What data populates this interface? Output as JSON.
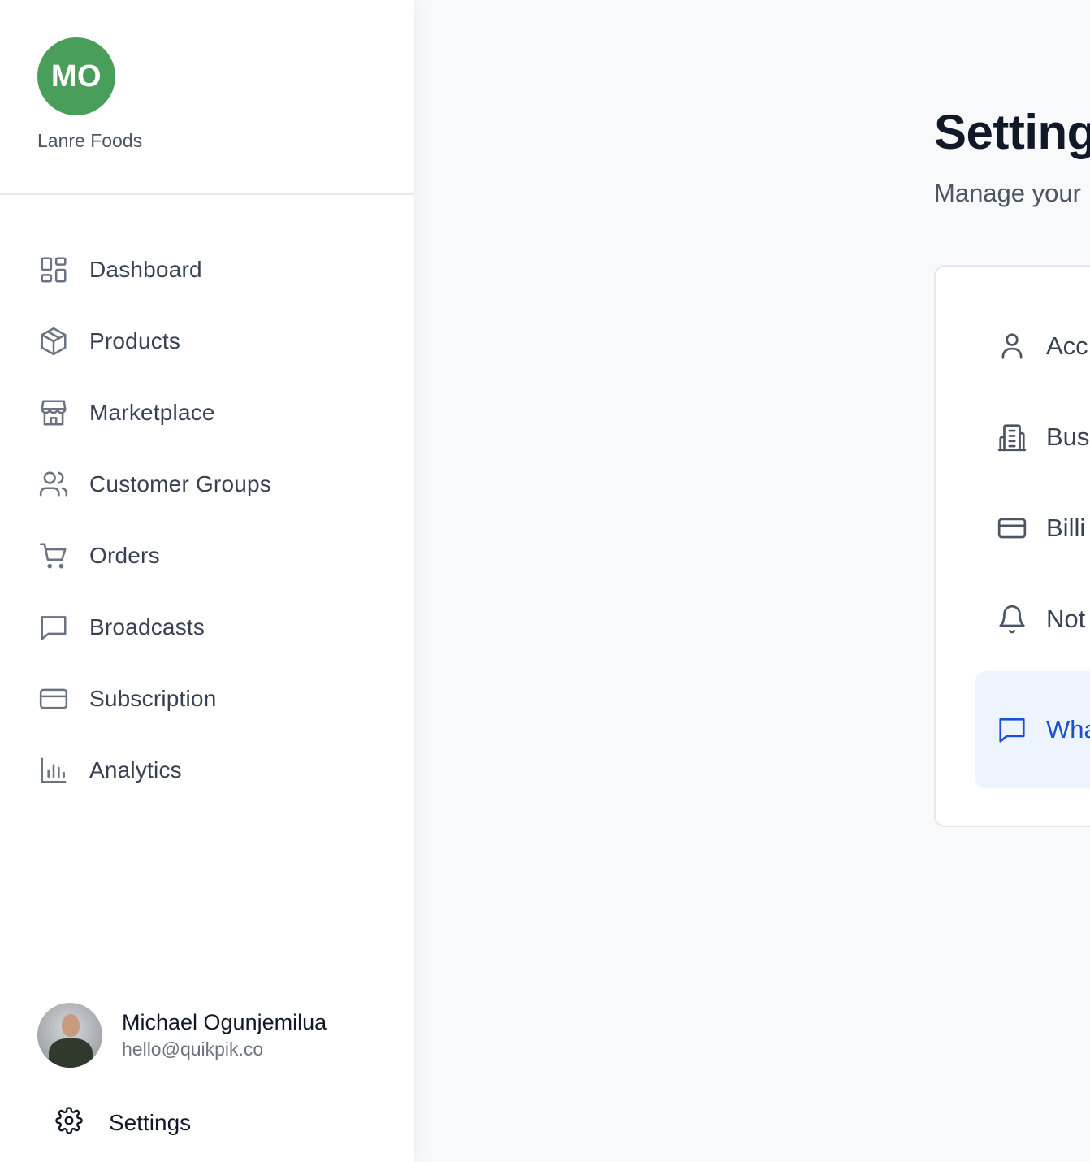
{
  "brand": {
    "initials": "MO",
    "name": "Lanre Foods",
    "avatar_color": "#4a9e5c"
  },
  "nav": {
    "items": [
      {
        "label": "Dashboard",
        "icon": "dashboard-grid-icon"
      },
      {
        "label": "Products",
        "icon": "box-icon"
      },
      {
        "label": "Marketplace",
        "icon": "store-icon"
      },
      {
        "label": "Customer Groups",
        "icon": "users-icon"
      },
      {
        "label": "Orders",
        "icon": "cart-icon"
      },
      {
        "label": "Broadcasts",
        "icon": "chat-bubble-icon"
      },
      {
        "label": "Subscription",
        "icon": "credit-card-icon"
      },
      {
        "label": "Analytics",
        "icon": "bar-chart-icon"
      }
    ]
  },
  "user": {
    "name": "Michael Ogunjemilua",
    "email": "hello@quikpik.co"
  },
  "footer": {
    "settings_label": "Settings",
    "settings_icon": "gear-icon"
  },
  "main": {
    "title": "Setting",
    "subtitle": "Manage your",
    "settings_menu": [
      {
        "label": "Acc",
        "icon": "user-icon",
        "active": false
      },
      {
        "label": "Bus",
        "icon": "building-icon",
        "active": false
      },
      {
        "label": "Billi",
        "icon": "credit-card-icon",
        "active": false
      },
      {
        "label": "Not",
        "icon": "bell-icon",
        "active": false
      },
      {
        "label": "Wha Integ",
        "icon": "chat-bubble-icon",
        "active": true
      }
    ]
  },
  "colors": {
    "accent": "#1d4ed8",
    "active_bg": "#eef4fd"
  }
}
